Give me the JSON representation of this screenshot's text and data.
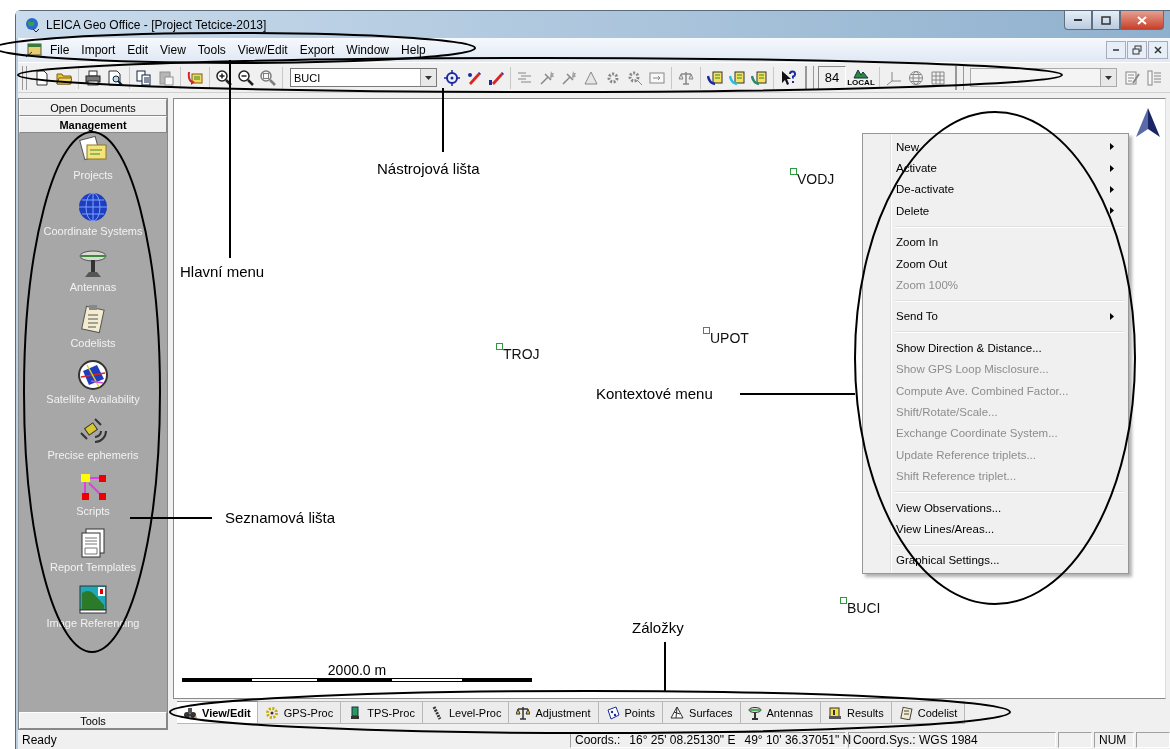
{
  "window": {
    "title": "LEICA Geo Office - [Project Tetcice-2013]"
  },
  "menu_bar": [
    "File",
    "Import",
    "Edit",
    "View",
    "Tools",
    "View/Edit",
    "Export",
    "Window",
    "Help"
  ],
  "toolbar": {
    "station_combo": "BUCI",
    "number_field": "84",
    "local_label": "LOCAL",
    "buttons": [
      {
        "disabled": false
      },
      {
        "disabled": false
      },
      {
        "disabled": false
      },
      {
        "disabled": false
      },
      {
        "disabled": false
      },
      {
        "disabled": true
      },
      {
        "disabled": false
      },
      {
        "disabled": false
      },
      {
        "disabled": false
      },
      {
        "disabled": true
      },
      {
        "disabled": false
      },
      {
        "disabled": false
      },
      {
        "disabled": false
      },
      {
        "disabled": true
      },
      {
        "disabled": true
      },
      {
        "disabled": true
      },
      {
        "disabled": true
      },
      {
        "disabled": true
      },
      {
        "disabled": true
      },
      {
        "disabled": true
      },
      {
        "disabled": true
      },
      {
        "disabled": false
      },
      {
        "disabled": false
      },
      {
        "disabled": false
      },
      {
        "disabled": false
      },
      {
        "disabled": false
      },
      {
        "disabled": true
      },
      {
        "disabled": true
      },
      {
        "disabled": true
      },
      {
        "disabled": true
      },
      {
        "disabled": true
      }
    ]
  },
  "sidebar": {
    "sections": [
      {
        "label": "Open Documents",
        "selected": false
      },
      {
        "label": "Management",
        "selected": true
      },
      {
        "label": "Tools",
        "selected": false
      }
    ],
    "items": [
      "Projects",
      "Coordinate Systems",
      "Antennas",
      "Codelists",
      "Satellite Availability",
      "Precise ephemeris",
      "Scripts",
      "Report Templates",
      "Image Referencing"
    ]
  },
  "map": {
    "points": [
      {
        "label": "VODJ"
      },
      {
        "label": "UPOT"
      },
      {
        "label": "TROJ"
      },
      {
        "label": "BUCI"
      }
    ],
    "scale_label": "2000.0 m"
  },
  "context_menu": {
    "groups": [
      {
        "items": [
          {
            "label": "New",
            "submenu": true,
            "disabled": false
          },
          {
            "label": "Activate",
            "submenu": true,
            "disabled": false
          },
          {
            "label": "De-activate",
            "submenu": true,
            "disabled": false
          },
          {
            "label": "Delete",
            "submenu": true,
            "disabled": false
          }
        ]
      },
      {
        "items": [
          {
            "label": "Zoom In",
            "submenu": false,
            "disabled": false
          },
          {
            "label": "Zoom Out",
            "submenu": false,
            "disabled": false
          },
          {
            "label": "Zoom 100%",
            "submenu": false,
            "disabled": true
          }
        ]
      },
      {
        "items": [
          {
            "label": "Send To",
            "submenu": true,
            "disabled": false
          }
        ]
      },
      {
        "items": [
          {
            "label": "Show Direction & Distance...",
            "submenu": false,
            "disabled": false
          },
          {
            "label": "Show GPS Loop Misclosure...",
            "submenu": false,
            "disabled": true
          },
          {
            "label": "Compute Ave. Combined Factor...",
            "submenu": false,
            "disabled": true
          },
          {
            "label": "Shift/Rotate/Scale...",
            "submenu": false,
            "disabled": true
          },
          {
            "label": "Exchange Coordinate System...",
            "submenu": false,
            "disabled": true
          },
          {
            "label": "Update Reference triplets...",
            "submenu": false,
            "disabled": true
          },
          {
            "label": "Shift Reference triplet...",
            "submenu": false,
            "disabled": true
          }
        ]
      },
      {
        "items": [
          {
            "label": "View Observations...",
            "submenu": false,
            "disabled": false
          },
          {
            "label": "View Lines/Areas...",
            "submenu": false,
            "disabled": false
          }
        ]
      },
      {
        "items": [
          {
            "label": "Graphical Settings...",
            "submenu": false,
            "disabled": false
          }
        ]
      }
    ]
  },
  "tabs": [
    {
      "label": "View/Edit",
      "selected": true
    },
    {
      "label": "GPS-Proc",
      "selected": false
    },
    {
      "label": "TPS-Proc",
      "selected": false
    },
    {
      "label": "Level-Proc",
      "selected": false
    },
    {
      "label": "Adjustment",
      "selected": false
    },
    {
      "label": "Points",
      "selected": false
    },
    {
      "label": "Surfaces",
      "selected": false
    },
    {
      "label": "Antennas",
      "selected": false
    },
    {
      "label": "Results",
      "selected": false
    },
    {
      "label": "Codelist",
      "selected": false
    }
  ],
  "status_bar": {
    "message": "Ready",
    "coords_label": "Coords.:",
    "longitude": "16° 25' 08.25130\" E",
    "latitude": "49° 10' 36.37051\" N",
    "coord_sys": "Coord.Sys.: WGS 1984",
    "num": "NUM"
  },
  "annotations": [
    {
      "label": "Nástrojová lišta"
    },
    {
      "label": "Hlavní menu"
    },
    {
      "label": "Kontextové menu"
    },
    {
      "label": "Seznamová lišta"
    },
    {
      "label": "Záložky"
    }
  ]
}
